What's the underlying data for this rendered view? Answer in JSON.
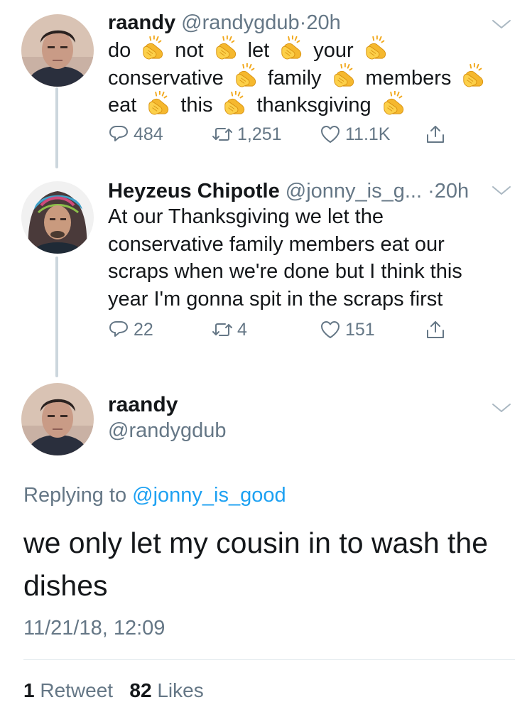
{
  "tweets": [
    {
      "display_name": "raandy",
      "handle": "@randygdub",
      "separator": "·",
      "time": "20h",
      "text_lines": [
        [
          "do",
          "not",
          "let",
          "your"
        ],
        [
          "conservative",
          "family",
          "members"
        ],
        [
          "eat",
          "this",
          "thanksgiving"
        ]
      ],
      "emoji": "clapping-hands",
      "replies": "484",
      "retweets": "1,251",
      "likes": "11.1K"
    },
    {
      "display_name": "Heyzeus Chipotle",
      "handle": "@jonny_is_g...",
      "separator": "·",
      "time": "20h",
      "text_lines": [
        "At our Thanksgiving we let the",
        "conservative family members eat our",
        "scraps when we're done but I think this",
        "year I'm gonna spit in the scraps first"
      ],
      "replies": "22",
      "retweets": "4",
      "likes": "151"
    }
  ],
  "main_tweet": {
    "display_name": "raandy",
    "handle": "@randygdub",
    "replying_prefix": "Replying to",
    "replying_to": "@jonny_is_good",
    "text": "we only let my cousin in to wash the dishes",
    "timestamp": "11/21/18, 12:09",
    "retweet_count": "1",
    "retweet_label": "Retweet",
    "like_count": "82",
    "like_label": "Likes"
  },
  "colors": {
    "text": "#14171a",
    "secondary": "#657786",
    "link": "#1da1f2",
    "thread_line": "#ccd6dd",
    "clap": "#f8c333"
  }
}
